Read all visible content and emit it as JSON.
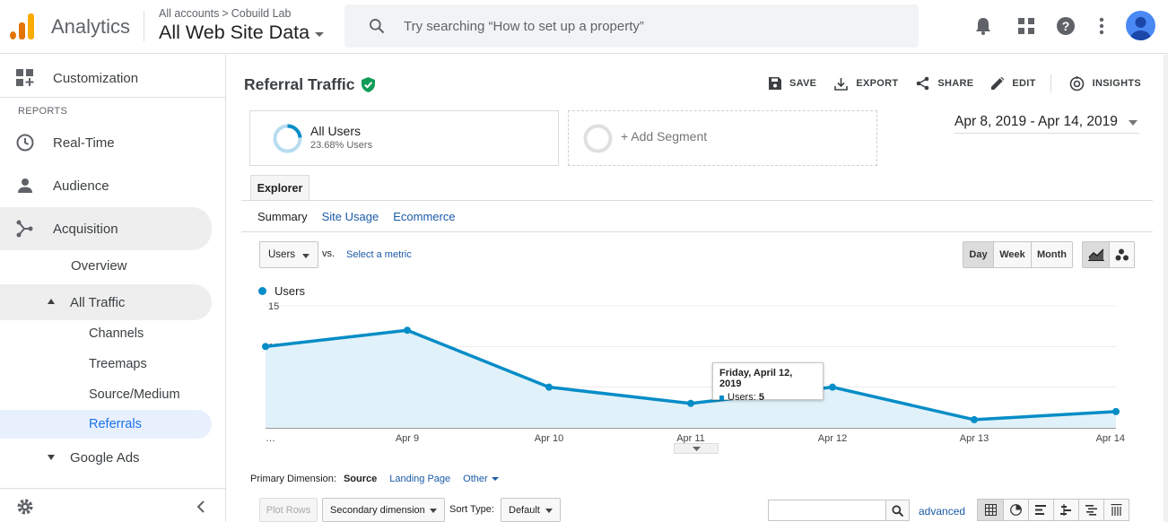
{
  "header": {
    "app_name": "Analytics",
    "account_path": {
      "root": "All accounts",
      "separator": ">",
      "account": "Cobuild Lab"
    },
    "view_name": "All Web Site Data",
    "search_placeholder": "Try searching “How to set up a property”",
    "icons": [
      "bell-icon",
      "apps-grid-icon",
      "help-icon",
      "more-vert-icon",
      "account-avatar-icon"
    ],
    "logo_colors": [
      "#f9ab00",
      "#e37400",
      "#e37400"
    ]
  },
  "sidebar": {
    "customization": "Customization",
    "section_reports": "REPORTS",
    "realtime": "Real-Time",
    "audience": "Audience",
    "acquisition": "Acquisition",
    "overview": "Overview",
    "all_traffic": "All Traffic",
    "channels": "Channels",
    "treemaps": "Treemaps",
    "source_medium": "Source/Medium",
    "referrals": "Referrals",
    "google_ads": "Google Ads",
    "active_item": "Referrals",
    "active_color": "#1a73e8"
  },
  "report": {
    "title": "Referral Traffic",
    "verified_icon": "verified-shield-icon",
    "actions": {
      "save": "SAVE",
      "export": "EXPORT",
      "share": "SHARE",
      "edit": "EDIT",
      "insights": "INSIGHTS"
    },
    "segment": {
      "name": "All Users",
      "subtitle": "23.68% Users",
      "add": "+ Add Segment",
      "ring_fraction": 0.2368
    },
    "date_range": "Apr 8, 2019 - Apr 14, 2019",
    "tab": "Explorer",
    "subtabs": {
      "summary": "Summary",
      "site_usage": "Site Usage",
      "ecommerce": "Ecommerce"
    },
    "metric": {
      "selected": "Users",
      "vs": "vs.",
      "select_metric": "Select a metric"
    },
    "granularity": {
      "day": "Day",
      "week": "Week",
      "month": "Month",
      "selected": "Day"
    },
    "chart_legend": "Users",
    "series_color": "#058dc7",
    "tooltip": {
      "date": "Friday, April 12, 2019",
      "label": "Users:",
      "value": "5"
    },
    "primary_dimension": {
      "label": "Primary Dimension:",
      "source": "Source",
      "landing_page": "Landing Page",
      "other": "Other"
    },
    "table_controls": {
      "plot_rows": "Plot Rows",
      "secondary_dimension": "Secondary dimension",
      "sort_type_label": "Sort Type:",
      "sort_type_value": "Default",
      "advanced": "advanced"
    }
  },
  "chart_data": {
    "type": "area",
    "x": [
      "…",
      "Apr 9",
      "Apr 10",
      "Apr 11",
      "Apr 12",
      "Apr 13",
      "Apr 14"
    ],
    "series": [
      {
        "name": "Users",
        "values": [
          10,
          12,
          5,
          3,
          5,
          1,
          2
        ]
      }
    ],
    "yticks": [
      5,
      10,
      15
    ],
    "ylim": [
      0,
      15
    ],
    "grid": true,
    "legend": "top-left"
  }
}
